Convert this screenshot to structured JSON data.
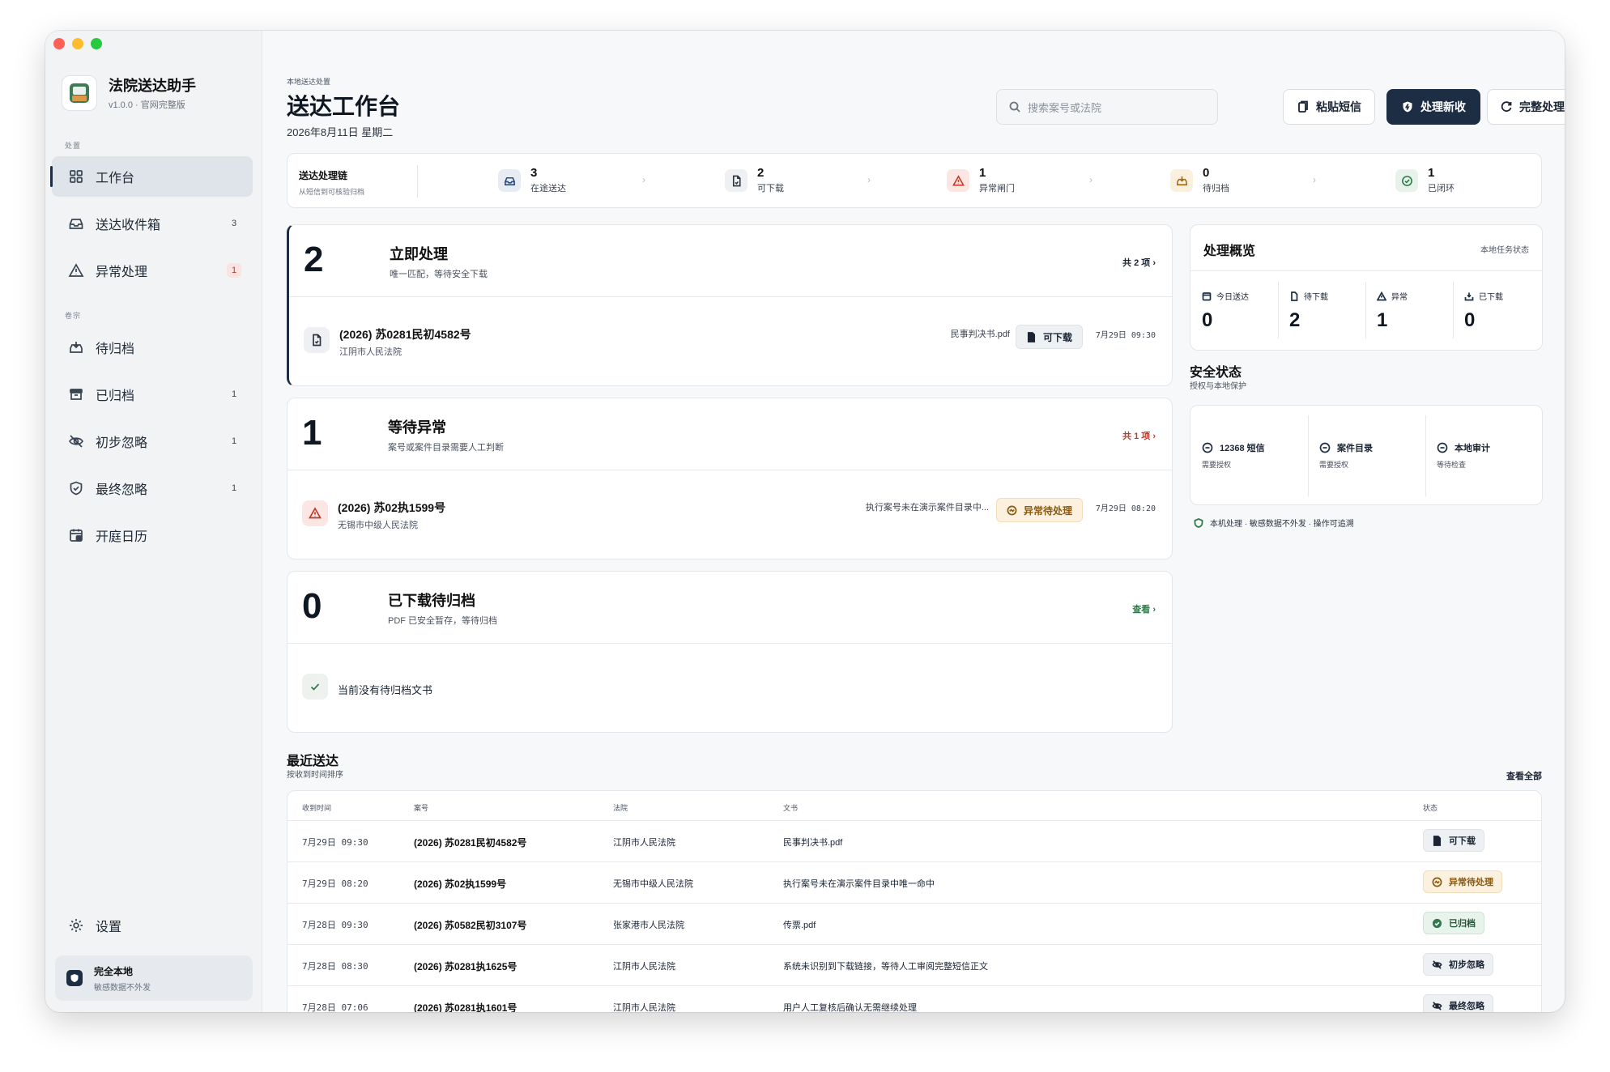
{
  "app": {
    "name": "法院送达助手",
    "version": "v1.0.0 · 官网完整版"
  },
  "sidebar": {
    "section1": "处置",
    "section2": "卷宗",
    "items": [
      {
        "label": "工作台",
        "count": "",
        "icon": "grid-icon"
      },
      {
        "label": "送达收件箱",
        "count": "3",
        "icon": "inbox-icon"
      },
      {
        "label": "异常处理",
        "count": "1",
        "icon": "warning-icon"
      },
      {
        "label": "待归档",
        "count": "",
        "icon": "archive-tray-icon"
      },
      {
        "label": "已归档",
        "count": "1",
        "icon": "archive-box-icon"
      },
      {
        "label": "初步忽略",
        "count": "1",
        "icon": "eye-off-icon"
      },
      {
        "label": "最终忽略",
        "count": "1",
        "icon": "shield-check-icon"
      },
      {
        "label": "开庭日历",
        "count": "",
        "icon": "calendar-icon"
      }
    ],
    "settings": "设置",
    "local": {
      "title": "完全本地",
      "sub": "敏感数据不外发"
    }
  },
  "header": {
    "crumb": "本地送达处置",
    "title": "送达工作台",
    "date": "2026年8月11日 星期二",
    "search_placeholder": "搜索案号或法院",
    "btn_paste": "粘贴短信",
    "btn_process": "处理新收",
    "btn_complete": "完整处理"
  },
  "chain": {
    "title": "送达处理链",
    "sub": "从短信到可核验归档",
    "steps": [
      {
        "n": "3",
        "label": "在途送达"
      },
      {
        "n": "2",
        "label": "可下载"
      },
      {
        "n": "1",
        "label": "异常闸门"
      },
      {
        "n": "0",
        "label": "待归档"
      },
      {
        "n": "1",
        "label": "已闭环"
      }
    ]
  },
  "panels": {
    "immediate": {
      "count": "2",
      "title": "立即处理",
      "sub": "唯一匹配，等待安全下载",
      "more": "共 2 项",
      "row": {
        "case": "(2026) 苏0281民初4582号",
        "court": "江阴市人民法院",
        "doc": "民事判决书.pdf",
        "chip": "可下载",
        "time": "7月29日 09:30"
      }
    },
    "abnormal": {
      "count": "1",
      "title": "等待异常",
      "sub": "案号或案件目录需要人工判断",
      "more": "共 1 项",
      "row": {
        "case": "(2026) 苏02执1599号",
        "court": "无锡市中级人民法院",
        "doc": "执行案号未在演示案件目录中...",
        "chip": "异常待处理",
        "time": "7月29日 08:20"
      }
    },
    "archive": {
      "count": "0",
      "title": "已下载待归档",
      "sub": "PDF 已安全暂存，等待归档",
      "more": "查看",
      "empty": "当前没有待归档文书"
    }
  },
  "overview": {
    "title": "处理概览",
    "note": "本地任务状态",
    "cells": [
      {
        "label": "今日送达",
        "value": "0"
      },
      {
        "label": "待下载",
        "value": "2"
      },
      {
        "label": "异常",
        "value": "1"
      },
      {
        "label": "已下载",
        "value": "0"
      }
    ]
  },
  "security": {
    "title": "安全状态",
    "sub": "授权与本地保护",
    "cells": [
      {
        "label": "12368 短信",
        "sub": "需要授权"
      },
      {
        "label": "案件目录",
        "sub": "需要授权"
      },
      {
        "label": "本地审计",
        "sub": "等待检查"
      }
    ],
    "note": "本机处理 · 敏感数据不外发 · 操作可追溯"
  },
  "recent": {
    "title": "最近送达",
    "sub": "按收到时间排序",
    "all": "查看全部",
    "columns": [
      "收到时间",
      "案号",
      "法院",
      "文书",
      "状态"
    ],
    "rows": [
      {
        "time": "7月29日 09:30",
        "case": "(2026) 苏0281民初4582号",
        "court": "江阴市人民法院",
        "doc": "民事判决书.pdf",
        "status": "可下载",
        "kind": "gray"
      },
      {
        "time": "7月29日 08:20",
        "case": "(2026) 苏02执1599号",
        "court": "无锡市中级人民法院",
        "doc": "执行案号未在演示案件目录中唯一命中",
        "status": "异常待处理",
        "kind": "amber"
      },
      {
        "time": "7月28日 09:30",
        "case": "(2026) 苏0582民初3107号",
        "court": "张家港市人民法院",
        "doc": "传票.pdf",
        "status": "已归档",
        "kind": "green"
      },
      {
        "time": "7月28日 08:30",
        "case": "(2026) 苏0281执1625号",
        "court": "江阴市人民法院",
        "doc": "系统未识别到下载链接，等待人工审阅完整短信正文",
        "status": "初步忽略",
        "kind": "gray"
      },
      {
        "time": "7月28日 07:06",
        "case": "(2026) 苏0281执1601号",
        "court": "江阴市人民法院",
        "doc": "用户人工复核后确认无需继续处理",
        "status": "最终忽略",
        "kind": "gray"
      }
    ]
  },
  "colors": {
    "accent": "#1d2e44",
    "danger": "#c0392b",
    "warning": "#a86b12",
    "success": "#2f7a4a"
  }
}
